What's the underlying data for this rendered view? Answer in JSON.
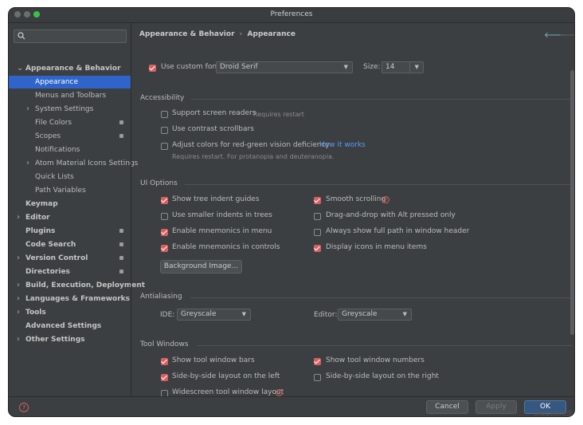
{
  "window": {
    "title": "Preferences"
  },
  "breadcrumb": {
    "parent": "Appearance & Behavior",
    "sep": "›",
    "current": "Appearance"
  },
  "sidebar": {
    "items": [
      {
        "label": "Appearance & Behavior",
        "bold": true,
        "arrow": "down",
        "indent": 0
      },
      {
        "label": "Appearance",
        "selected": true,
        "indent": 1
      },
      {
        "label": "Menus and Toolbars",
        "indent": 1
      },
      {
        "label": "System Settings",
        "arrow": "right",
        "indent": 1
      },
      {
        "label": "File Colors",
        "badge": true,
        "indent": 1
      },
      {
        "label": "Scopes",
        "badge": true,
        "indent": 1
      },
      {
        "label": "Notifications",
        "indent": 1
      },
      {
        "label": "Atom Material Icons Settings",
        "arrow": "right",
        "indent": 1
      },
      {
        "label": "Quick Lists",
        "indent": 1
      },
      {
        "label": "Path Variables",
        "indent": 1
      },
      {
        "label": "Keymap",
        "bold": true,
        "indent": 0
      },
      {
        "label": "Editor",
        "bold": true,
        "arrow": "right",
        "indent": 0
      },
      {
        "label": "Plugins",
        "bold": true,
        "badge": true,
        "indent": 0
      },
      {
        "label": "Code Search",
        "bold": true,
        "badge": true,
        "indent": 0
      },
      {
        "label": "Version Control",
        "bold": true,
        "arrow": "right",
        "badge": true,
        "indent": 0
      },
      {
        "label": "Directories",
        "bold": true,
        "badge": true,
        "indent": 0
      },
      {
        "label": "Build, Execution, Deployment",
        "bold": true,
        "arrow": "right",
        "indent": 0
      },
      {
        "label": "Languages & Frameworks",
        "bold": true,
        "arrow": "right",
        "indent": 0
      },
      {
        "label": "Tools",
        "bold": true,
        "arrow": "right",
        "indent": 0
      },
      {
        "label": "Advanced Settings",
        "bold": true,
        "indent": 0
      },
      {
        "label": "Other Settings",
        "bold": true,
        "arrow": "right",
        "indent": 0
      }
    ]
  },
  "font": {
    "use_custom_label": "Use custom font:",
    "use_custom_checked": true,
    "font_value": "Droid Serif",
    "size_label": "Size:",
    "size_value": "14"
  },
  "accessibility": {
    "title": "Accessibility",
    "screen_readers": "Support screen readers",
    "screen_readers_note": "Requires restart",
    "contrast_scrollbars": "Use contrast scrollbars",
    "adjust_colors": "Adjust colors for red-green vision deficiency",
    "how_it_works": "How it works",
    "adjust_note": "Requires restart. For protanopia and deuteranopia."
  },
  "ui_options": {
    "title": "UI Options",
    "left": [
      {
        "label": "Show tree indent guides",
        "checked": true
      },
      {
        "label": "Use smaller indents in trees",
        "checked": false
      },
      {
        "label": "Enable mnemonics in menu",
        "checked": true
      },
      {
        "label": "Enable mnemonics in controls",
        "checked": true
      }
    ],
    "right": [
      {
        "label": "Smooth scrolling",
        "checked": true
      },
      {
        "label": "Drag-and-drop with Alt pressed only",
        "checked": false
      },
      {
        "label": "Always show full path in window header",
        "checked": false
      },
      {
        "label": "Display icons in menu items",
        "checked": true
      }
    ],
    "background_button": "Background Image..."
  },
  "antialiasing": {
    "title": "Antialiasing",
    "ide_label": "IDE:",
    "ide_value": "Greyscale",
    "editor_label": "Editor:",
    "editor_value": "Greyscale"
  },
  "tool_windows": {
    "title": "Tool Windows",
    "show_bars": "Show tool window bars",
    "show_numbers": "Show tool window numbers",
    "side_left": "Side-by-side layout on the left",
    "side_right": "Side-by-side layout on the right",
    "widescreen": "Widescreen tool window layout"
  },
  "footer": {
    "cancel": "Cancel",
    "apply": "Apply",
    "ok": "OK"
  },
  "watermark": "@稀金技术社区",
  "colors": {
    "accent": "#2f65ca",
    "checkbox_on": "#d86060",
    "link": "#589df6",
    "background": "#3c3f41"
  }
}
